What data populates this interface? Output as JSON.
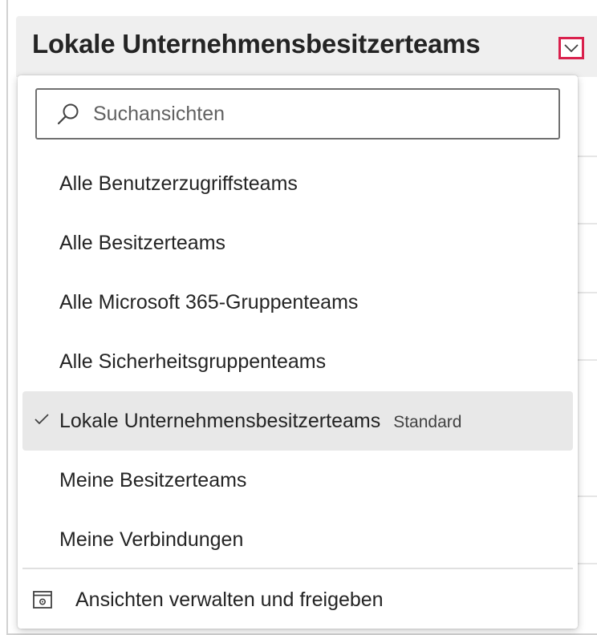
{
  "header": {
    "title": "Lokale Unternehmensbesitzerteams"
  },
  "search": {
    "placeholder": "Suchansichten",
    "value": ""
  },
  "views": [
    {
      "label": "Alle Benutzerzugriffsteams",
      "selected": false
    },
    {
      "label": "Alle Besitzerteams",
      "selected": false
    },
    {
      "label": "Alle Microsoft 365-Gruppenteams",
      "selected": false
    },
    {
      "label": "Alle Sicherheitsgruppenteams",
      "selected": false
    },
    {
      "label": "Lokale Unternehmensbesitzerteams",
      "selected": true,
      "badge": "Standard"
    },
    {
      "label": "Meine Besitzerteams",
      "selected": false
    },
    {
      "label": "Meine Verbindungen",
      "selected": false
    }
  ],
  "footer": {
    "manage_label": "Ansichten verwalten und freigeben"
  },
  "icons": {
    "chevron": "chevron-down-icon",
    "search": "search-icon",
    "check": "checkmark-icon",
    "manage": "settings-window-icon"
  },
  "colors": {
    "focus_outline": "#d9214d",
    "selected_row": "#e8e8e8",
    "header_bg": "#efefef"
  }
}
